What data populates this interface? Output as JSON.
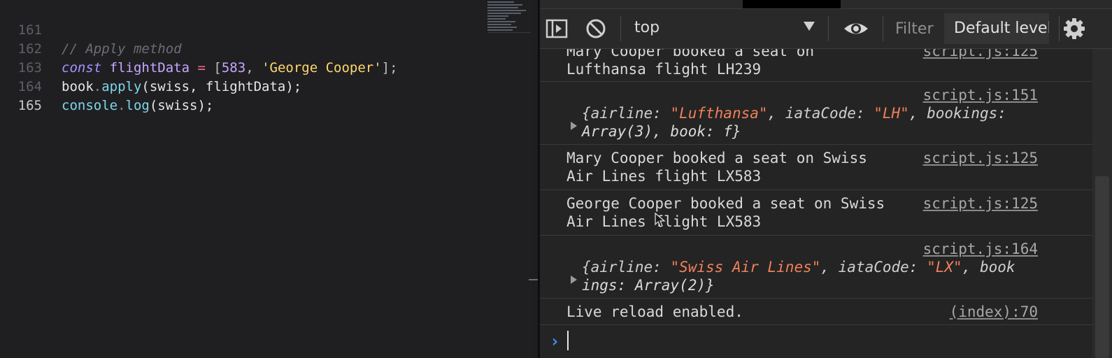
{
  "editor": {
    "lines": [
      {
        "number": "161",
        "comment": "// Apply method"
      },
      {
        "number": "162",
        "kw": "const",
        "var": "flightData",
        "op": "=",
        "p1": "[",
        "num": "583",
        "p2": ", ",
        "str": "'George Cooper'",
        "p3": "];"
      },
      {
        "number": "163",
        "obj": "book",
        "dot": ".",
        "method": "apply",
        "args": "(swiss, flightData);"
      },
      {
        "number": "164",
        "obj": "console",
        "dot": ".",
        "method": "log",
        "args": "(swiss);"
      },
      {
        "number": "165"
      }
    ]
  },
  "devtools": {
    "toolbar": {
      "sidebar_icon": "sidebar-toggle-icon",
      "clear_icon": "clear-console-icon",
      "context": "top",
      "eye_icon": "eye-icon",
      "filter_placeholder": "Filter",
      "levels": "Default levels",
      "settings_icon": "gear-icon"
    },
    "messages": [
      {
        "lines": [
          "Mary Cooper booked a seat on",
          "Lufthansa flight LH239"
        ],
        "source": "script.js:125"
      },
      {
        "source": "script.js:151",
        "object": {
          "l1_a": "{airline: ",
          "l1_b": "\"Lufthansa\"",
          "l1_c": ", iataCode: ",
          "l1_d": "\"LH\"",
          "l1_e": ", bookings:",
          "l2": "Array(3), book: f}"
        }
      },
      {
        "lines": [
          "Mary Cooper booked a seat on Swiss",
          "Air Lines flight LX583"
        ],
        "source": "script.js:125"
      },
      {
        "lines": [
          "George Cooper booked a seat on Swiss",
          "Air Lines flight LX583"
        ],
        "source": "script.js:125"
      },
      {
        "source": "script.js:164",
        "object": {
          "l1_a": "{airline: ",
          "l1_b": "\"Swiss Air Lines\"",
          "l1_c": ", iataCode: ",
          "l1_d": "\"LX\"",
          "l1_e": ", book",
          "l2": "ings: Array(2)}"
        }
      },
      {
        "lines": [
          "Live reload enabled."
        ],
        "source": "(index):70"
      }
    ],
    "prompt_symbol": "›"
  },
  "colors": {
    "editor_bg": "#1f1f22",
    "devtools_bg": "#242424",
    "string_orange": "#f0805a",
    "prompt_blue": "#3f8cff"
  }
}
